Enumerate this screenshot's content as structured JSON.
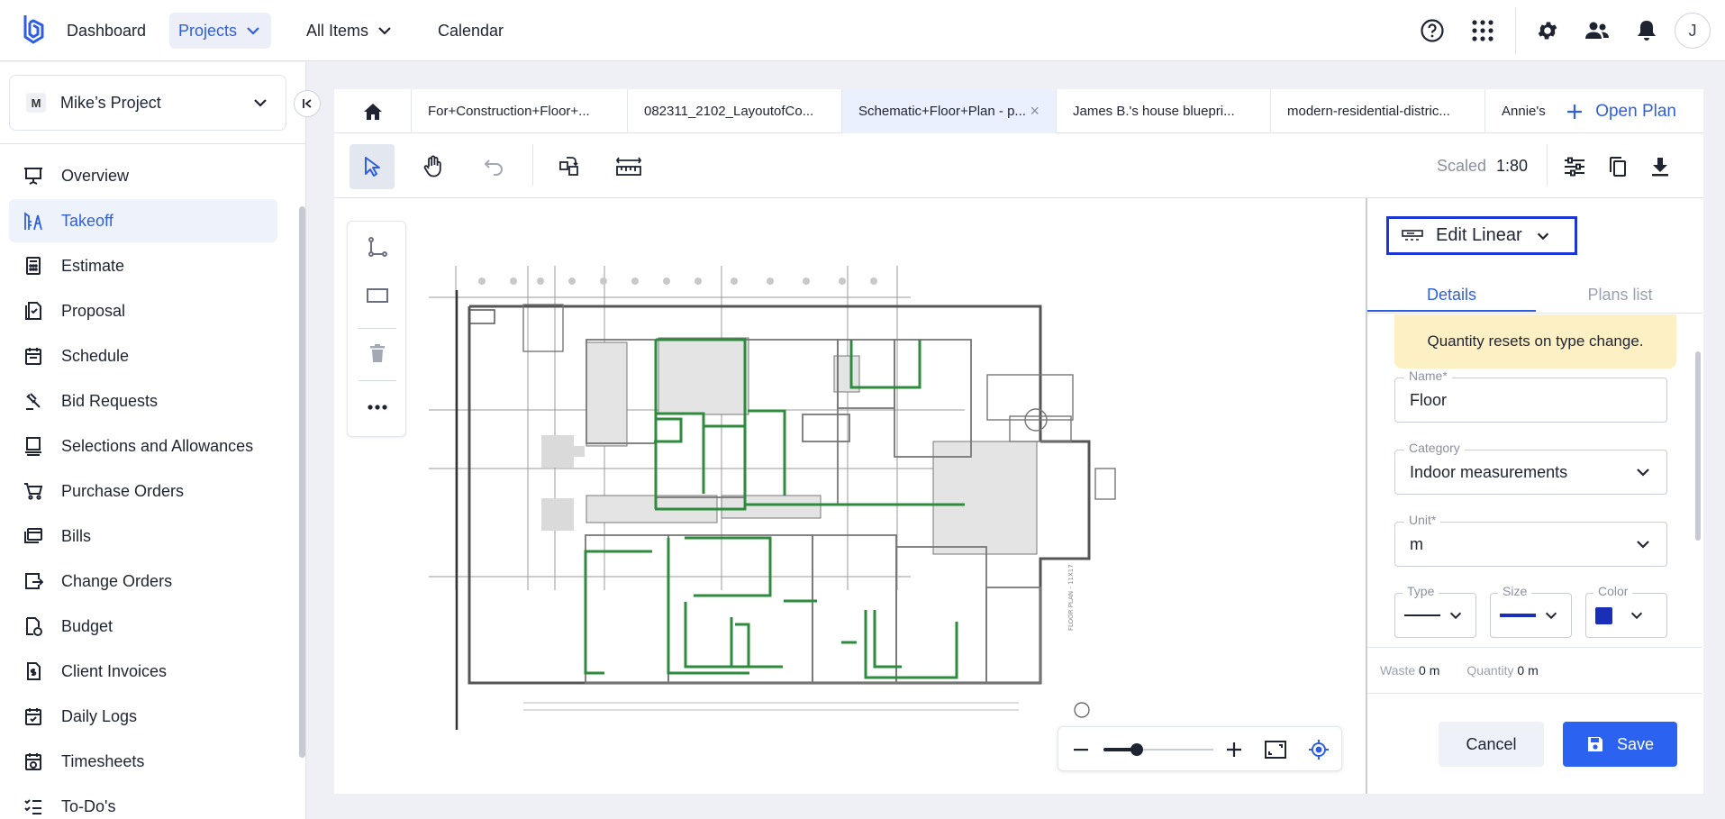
{
  "nav": {
    "dashboard": "Dashboard",
    "projects": "Projects",
    "all_items": "All Items",
    "calendar": "Calendar",
    "avatar_initial": "J"
  },
  "project": {
    "badge": "M",
    "name": "Mike’s Project"
  },
  "sidebar": {
    "items": [
      {
        "label": "Overview",
        "icon": "presentation-icon"
      },
      {
        "label": "Takeoff",
        "icon": "takeoff-icon",
        "active": true
      },
      {
        "label": "Estimate",
        "icon": "calculator-icon"
      },
      {
        "label": "Proposal",
        "icon": "proposal-icon"
      },
      {
        "label": "Schedule",
        "icon": "calendar-icon"
      },
      {
        "label": "Bid Requests",
        "icon": "gavel-icon"
      },
      {
        "label": "Selections and Allowances",
        "icon": "selections-icon"
      },
      {
        "label": "Purchase Orders",
        "icon": "cart-icon"
      },
      {
        "label": "Bills",
        "icon": "bills-icon"
      },
      {
        "label": "Change Orders",
        "icon": "change-orders-icon"
      },
      {
        "label": "Budget",
        "icon": "budget-icon"
      },
      {
        "label": "Client Invoices",
        "icon": "invoice-icon"
      },
      {
        "label": "Daily Logs",
        "icon": "daily-logs-icon"
      },
      {
        "label": "Timesheets",
        "icon": "timesheets-icon"
      },
      {
        "label": "To-Do's",
        "icon": "todo-icon"
      }
    ]
  },
  "tabs": [
    {
      "label": "For+Construction+Floor+..."
    },
    {
      "label": "082311_2102_LayoutofCo..."
    },
    {
      "label": "Schematic+Floor+Plan - p...",
      "active": true
    },
    {
      "label": "James B.'s house bluepri..."
    },
    {
      "label": "modern-residential-distric..."
    },
    {
      "label": "Annie's"
    }
  ],
  "open_plan": "Open Plan",
  "toolbar": {
    "scaled_label": "Scaled",
    "scale_value": "1:80"
  },
  "zoom": {
    "level": 0.3
  },
  "panel": {
    "mode": "Edit Linear",
    "tab_details": "Details",
    "tab_plans": "Plans list",
    "notice": "Quantity resets on type change.",
    "name_label": "Name*",
    "name_value": "Floor",
    "category_label": "Category",
    "category_value": "Indoor measurements",
    "unit_label": "Unit*",
    "unit_value": "m",
    "type_label": "Type",
    "size_label": "Size",
    "color_label": "Color",
    "color_value": "#1a2fb8",
    "waste_label": "Waste",
    "waste_value": "0 m",
    "quantity_label": "Quantity",
    "quantity_value": "0 m",
    "cancel": "Cancel",
    "save": "Save"
  },
  "colors": {
    "accent": "#2f5fe0",
    "save": "#2b62f0",
    "wall_highlight": "#2e8b3e"
  }
}
